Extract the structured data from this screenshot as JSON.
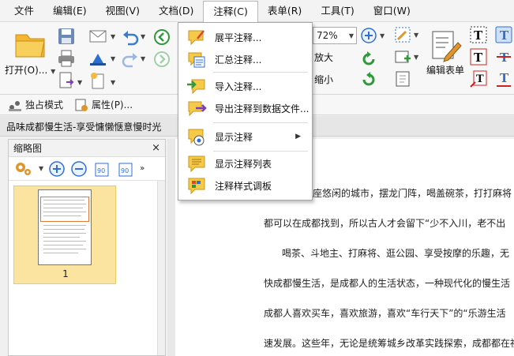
{
  "menubar": {
    "items": [
      "文件",
      "编辑(E)",
      "视图(V)",
      "文档(D)",
      "注释(C)",
      "表单(R)",
      "工具(T)",
      "窗口(W)"
    ],
    "active_index": 4
  },
  "ribbon": {
    "open_label": "打开(O)...",
    "zoom_value": "72%",
    "zoom_in_label": "放大",
    "zoom_out_label": "缩小",
    "edit_form_label": "编辑表单"
  },
  "toolbar2": {
    "solo_mode_label": "独占模式",
    "properties_label": "属性(P)..."
  },
  "doc_tab": {
    "title": "品味成都慢生活-享受慵懒惬意慢时光"
  },
  "left_panel": {
    "title": "缩略图",
    "close_glyph": "×",
    "page_number": "1"
  },
  "document": {
    "lines": [
      "一座悠闲的城市，摆龙门阵，喝盖碗茶，打打麻将",
      "都可以在成都找到，所以古人才会留下“少不入川，老不出",
      "喝茶、斗地主、打麻将、逛公园、享受按摩的乐趣，无",
      "快成都慢生活，是成都人的生活状态，一种现代化的慢生活",
      "成都人喜欢买车，喜欢旅游，喜欢“车行天下”的“乐游生活",
      "速发展。这些年，无论是统筹城乡改革实践探索，成都都在社会"
    ]
  },
  "annotation_menu": {
    "items": [
      {
        "label": "展平注释...",
        "icon": "flatten-annotations-icon"
      },
      {
        "label": "汇总注释...",
        "icon": "summarize-annotations-icon"
      },
      {
        "label": "导入注释...",
        "icon": "import-annotations-icon"
      },
      {
        "label": "导出注释到数据文件...",
        "icon": "export-annotations-icon"
      },
      {
        "label": "显示注释",
        "icon": "show-annotations-icon",
        "submenu_arrow": "▶"
      },
      {
        "label": "显示注释列表",
        "icon": "annotation-list-icon"
      },
      {
        "label": "注释样式调板",
        "icon": "annotation-style-palette-icon"
      }
    ]
  },
  "colors": {
    "note_yellow": "#f7c948",
    "accent_blue": "#2f6fd6",
    "green_arrow": "#2f9a3b",
    "thumb_highlight": "#fbe3a0"
  }
}
